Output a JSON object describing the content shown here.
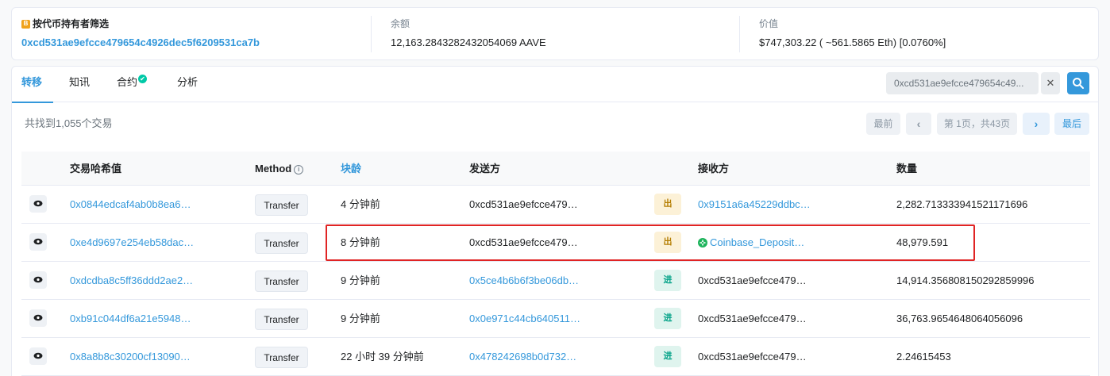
{
  "summary": {
    "filter_label": "按代币持有者筛选",
    "filter_icon": "token-badge-icon",
    "address": "0xcd531ae9efcce479654c4926dec5f6209531ca7b",
    "balance_label": "余额",
    "balance_value": "12,163.2843282432054069 AAVE",
    "value_label": "价值",
    "value_value": "$747,303.22 ( ~561.5865 Eth) [0.0760%]"
  },
  "tabs": [
    {
      "label": "转移",
      "active": true
    },
    {
      "label": "知讯",
      "active": false
    },
    {
      "label": "合约",
      "active": false,
      "verified": true
    },
    {
      "label": "分析",
      "active": false
    }
  ],
  "search": {
    "value": "0xcd531ae9efcce479654c49...",
    "clear_label": "✕"
  },
  "found_text": "共找到1,055个交易",
  "pager": {
    "first": "最前",
    "prev": "‹",
    "page": "第 1页，共43页",
    "next": "›",
    "last": "最后"
  },
  "columns": {
    "hash": "交易哈希值",
    "method": "Method",
    "age": "块龄",
    "from": "发送方",
    "to": "接收方",
    "quantity": "数量"
  },
  "rows": [
    {
      "hash": "0x0844edcaf4ab0b8ea6…",
      "method": "Transfer",
      "age": "4 分钟前",
      "from": "0xcd531ae9efcce479…",
      "dir": "出",
      "to": "0x9151a6a45229ddbc…",
      "qty": "2,282.713333941521171696"
    },
    {
      "hash": "0xe4d9697e254eb58dac…",
      "method": "Transfer",
      "age": "8 分钟前",
      "from": "0xcd531ae9efcce479…",
      "dir": "出",
      "to": "Coinbase_Deposit…",
      "qty": "48,979.591"
    },
    {
      "hash": "0xdcdba8c5ff36ddd2ae2…",
      "method": "Transfer",
      "age": "9 分钟前",
      "from": "0x5ce4b6b6f3be06db…",
      "dir": "进",
      "to": "0xcd531ae9efcce479…",
      "qty": "14,914.356808150292859996"
    },
    {
      "hash": "0xb91c044df6a21e5948…",
      "method": "Transfer",
      "age": "9 分钟前",
      "from": "0x0e971c44cb640511…",
      "dir": "进",
      "to": "0xcd531ae9efcce479…",
      "qty": "36,763.9654648064056096"
    },
    {
      "hash": "0x8a8b8c30200cf13090…",
      "method": "Transfer",
      "age": "22 小时 39 分钟前",
      "from": "0x478242698b0d732…",
      "dir": "进",
      "to": "0xcd531ae9efcce479…",
      "qty": "2.24615453"
    }
  ],
  "colors": {
    "link": "#3498db",
    "highlight": "#e02424",
    "out_bg": "#fcf1d7",
    "in_bg": "#dff4ee"
  }
}
